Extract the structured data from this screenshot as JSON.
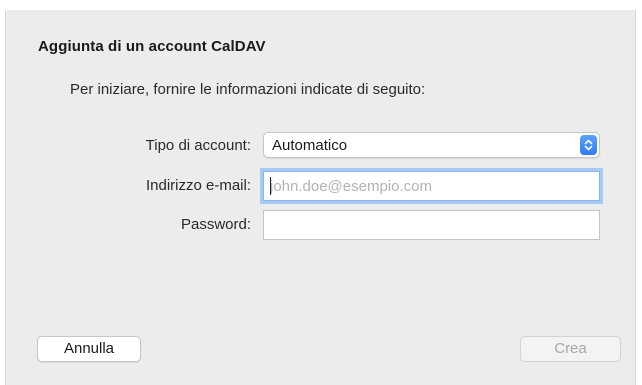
{
  "dialog": {
    "title": "Aggiunta di un account CalDAV",
    "intro": "Per iniziare, fornire le informazioni indicate di seguito:"
  },
  "form": {
    "account_type_label": "Tipo di account:",
    "account_type_value": "Automatico",
    "email_label": "Indirizzo e-mail:",
    "email_value": "",
    "email_placeholder": "john.doe@esempio.com",
    "password_label": "Password:",
    "password_value": ""
  },
  "buttons": {
    "cancel_label": "Annulla",
    "create_label": "Crea",
    "create_enabled": false
  },
  "colors": {
    "accent": "#2f7cf6",
    "focus_ring": "#a8c9f3",
    "background": "#ececec"
  },
  "icons": {
    "select_arrows": "chevron-up-down-icon"
  }
}
